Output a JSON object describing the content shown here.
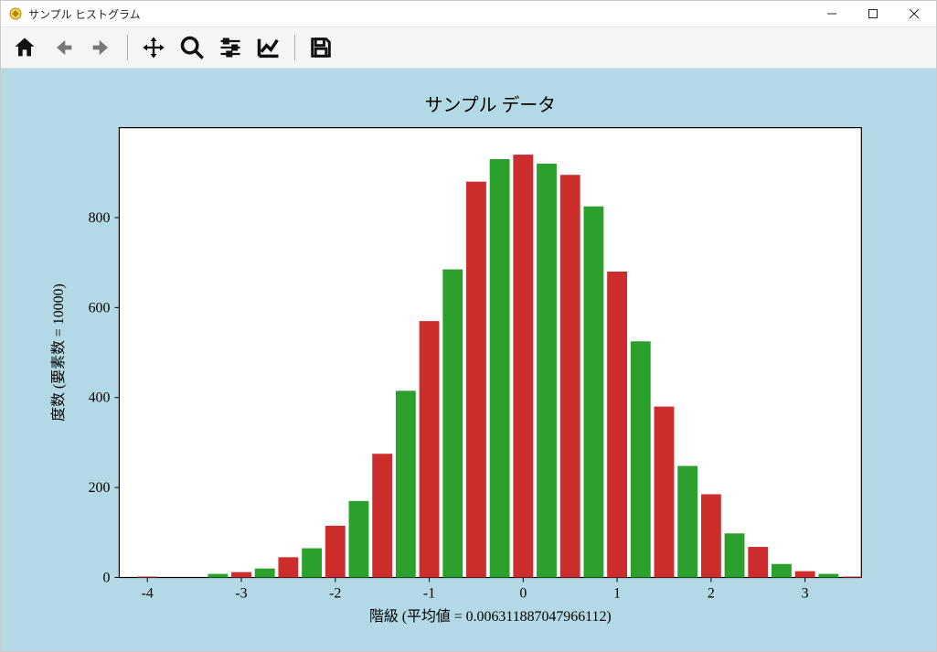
{
  "window": {
    "title": "サンプル ヒストグラム"
  },
  "toolbar": {
    "home": "Home",
    "back": "Back",
    "fwd": "Forward",
    "pan": "Pan",
    "zoom": "Zoom",
    "conf": "Configure",
    "edit": "Axes",
    "save": "Save"
  },
  "chart_data": {
    "type": "bar",
    "title": "サンプル データ",
    "xlabel": "階級 (平均値 = 0.006311887047966112)",
    "ylabel": "度数 (要素数 = 10000)",
    "xlim": [
      -4.3,
      3.6
    ],
    "ylim": [
      0,
      1000
    ],
    "xticks": [
      -4,
      -3,
      -2,
      -1,
      0,
      1,
      2,
      3
    ],
    "yticks": [
      0,
      200,
      400,
      600,
      800
    ],
    "bin_width": 0.25,
    "bin_centers": [
      -4.0,
      -3.75,
      -3.5,
      -3.25,
      -3.0,
      -2.75,
      -2.5,
      -2.25,
      -2.0,
      -1.75,
      -1.5,
      -1.25,
      -1.0,
      -0.75,
      -0.5,
      -0.25,
      0.0,
      0.25,
      0.5,
      0.75,
      1.0,
      1.25,
      1.5,
      1.75,
      2.0,
      2.25,
      2.5,
      2.75,
      3.0,
      3.25,
      3.5
    ],
    "values": [
      2,
      0,
      0,
      8,
      12,
      20,
      45,
      65,
      115,
      170,
      275,
      415,
      570,
      685,
      880,
      930,
      940,
      920,
      895,
      825,
      680,
      525,
      380,
      248,
      185,
      98,
      68,
      30,
      14,
      8,
      2
    ],
    "colors": {
      "even": "#cc2d2d",
      "odd": "#2ca02c"
    }
  }
}
